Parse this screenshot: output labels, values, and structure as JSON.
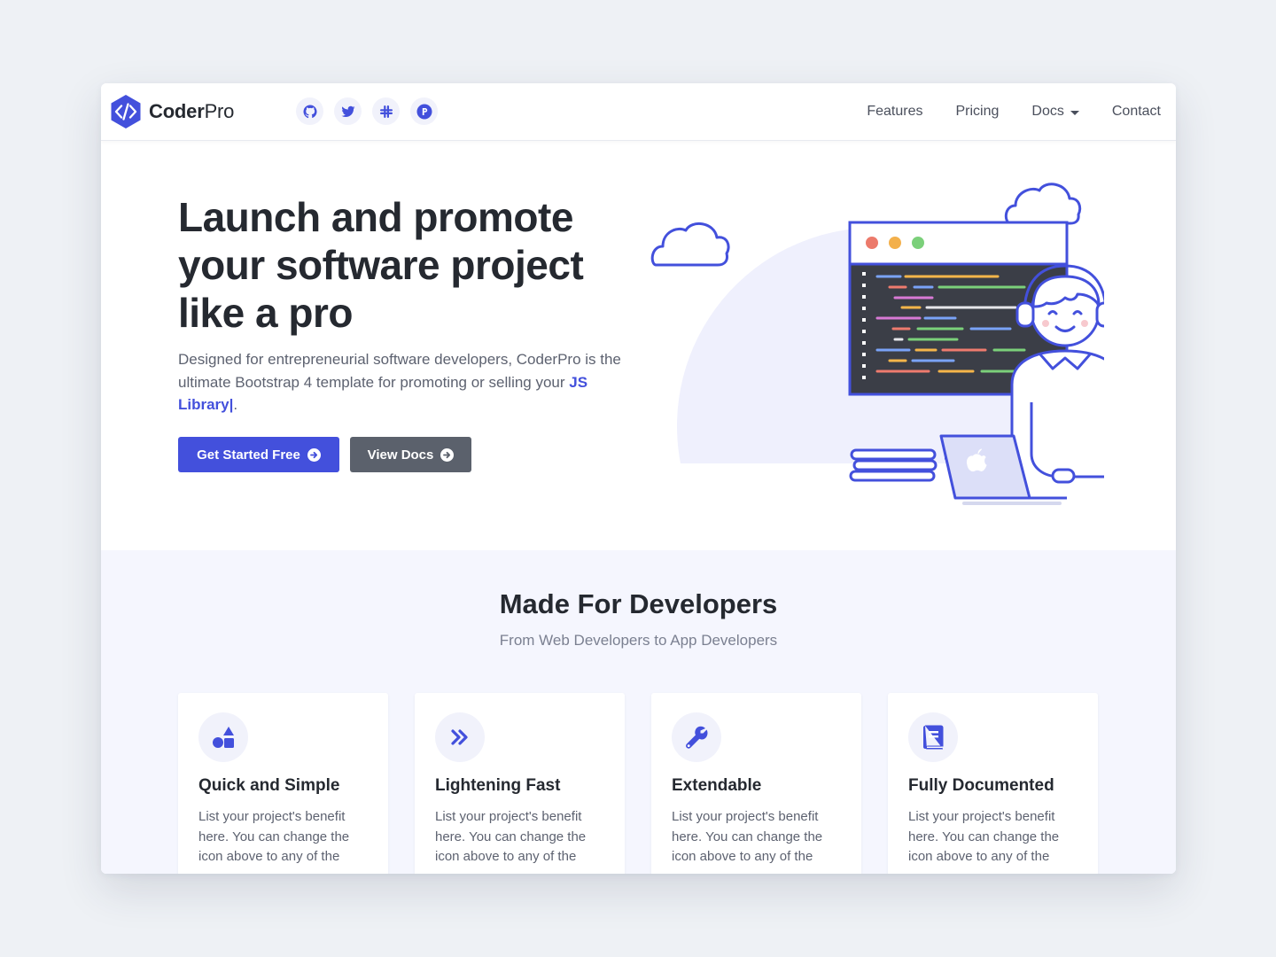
{
  "brand": {
    "name_bold": "Coder",
    "name_light": "Pro",
    "logo_icon": "code-icon"
  },
  "social_icons": [
    "github-icon",
    "twitter-icon",
    "slack-icon",
    "product-hunt-icon"
  ],
  "nav": {
    "features": "Features",
    "pricing": "Pricing",
    "docs": "Docs",
    "contact": "Contact"
  },
  "hero": {
    "title_line1": "Launch and promote",
    "title_line2": "your software project",
    "title_line3": "like a pro",
    "intro_before": "Designed for entrepreneurial software developers, CoderPro is the ultimate Bootstrap 4 template for promoting or selling your ",
    "intro_highlight": "JS Library|",
    "intro_after": ".",
    "primary_button": "Get Started Free",
    "secondary_button": "View Docs"
  },
  "features": {
    "title": "Made For Developers",
    "intro": "From Web Developers to App Developers",
    "cards": [
      {
        "icon": "shapes-icon",
        "title": "Quick and Simple",
        "text": "List your project's benefit here. You can change the icon above to any of the"
      },
      {
        "icon": "angle-double-right-icon",
        "title": "Lightening Fast",
        "text": "List your project's benefit here. You can change the icon above to any of the"
      },
      {
        "icon": "wrench-icon",
        "title": "Extendable",
        "text": "List your project's benefit here. You can change the icon above to any of the"
      },
      {
        "icon": "book-icon",
        "title": "Fully Documented",
        "text": "List your project's benefit here. You can change the icon above to any of the"
      }
    ]
  },
  "colors": {
    "primary": "#4350dc",
    "secondary": "#5b616c",
    "text": "#252930",
    "muted": "#5d6270",
    "section_bg": "#f5f6fe",
    "page_bg": "#eef1f5"
  }
}
